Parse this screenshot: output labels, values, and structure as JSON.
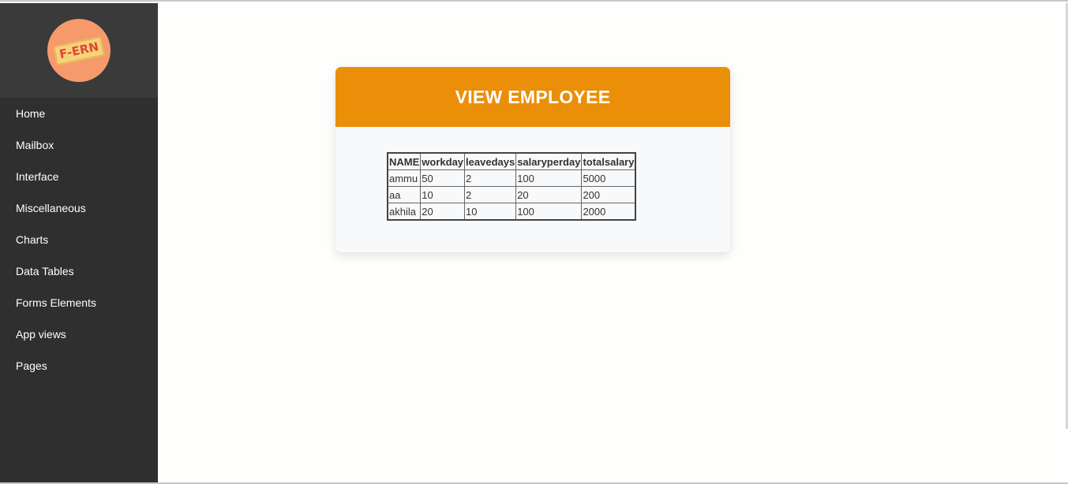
{
  "sidebar": {
    "logo_text": "F-ERN",
    "items": [
      {
        "label": "Home"
      },
      {
        "label": "Mailbox"
      },
      {
        "label": "Interface"
      },
      {
        "label": "Miscellaneous"
      },
      {
        "label": "Charts"
      },
      {
        "label": "Data Tables"
      },
      {
        "label": "Forms Elements"
      },
      {
        "label": "App views"
      },
      {
        "label": "Pages"
      }
    ]
  },
  "card": {
    "title": "VIEW EMPLOYEE"
  },
  "table": {
    "headers": [
      "NAME",
      "workday",
      "leavedays",
      "salaryperday",
      "totalsalary"
    ],
    "rows": [
      [
        "ammu",
        "50",
        "2",
        "100",
        "5000"
      ],
      [
        "aa",
        "10",
        "2",
        "20",
        "200"
      ],
      [
        "akhila",
        "20",
        "10",
        "100",
        "2000"
      ]
    ]
  },
  "colors": {
    "sidebar_bg": "#2f2f2f",
    "logo_area_bg": "#3a3a3a",
    "header_accent": "#ea8f07",
    "logo_circle": "#f79a6b"
  }
}
